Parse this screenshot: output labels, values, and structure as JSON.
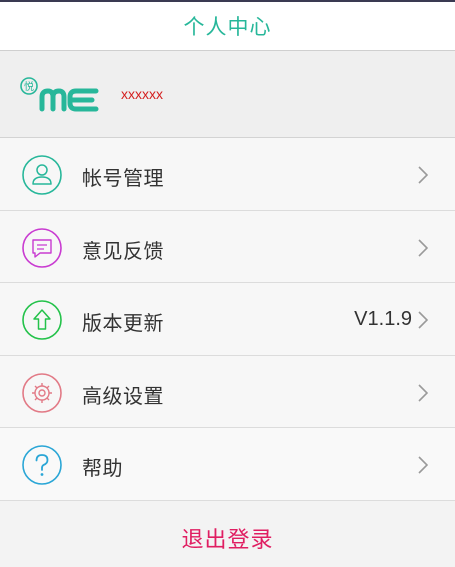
{
  "header": {
    "title": "个人中心"
  },
  "profile": {
    "logo": {
      "badge_text": "悦",
      "wordmark": "ME"
    },
    "username": "xxxxxx"
  },
  "menu": {
    "items": [
      {
        "label": "帐号管理",
        "icon": "user-icon",
        "color": "#27b79a"
      },
      {
        "label": "意见反馈",
        "icon": "chat-bubble-icon",
        "color": "#c93bd1"
      },
      {
        "label": "版本更新",
        "icon": "upload-arrow-icon",
        "color": "#23c24a",
        "value": "V1.1.9"
      },
      {
        "label": "高级设置",
        "icon": "gear-icon",
        "color": "#e27a86"
      },
      {
        "label": "帮助",
        "icon": "help-question-icon",
        "color": "#2aa6d6"
      }
    ]
  },
  "logout": {
    "label": "退出登录",
    "color": "#e01e62"
  },
  "theme": {
    "accent": "#27b79a",
    "username_color": "#d41f1f"
  }
}
